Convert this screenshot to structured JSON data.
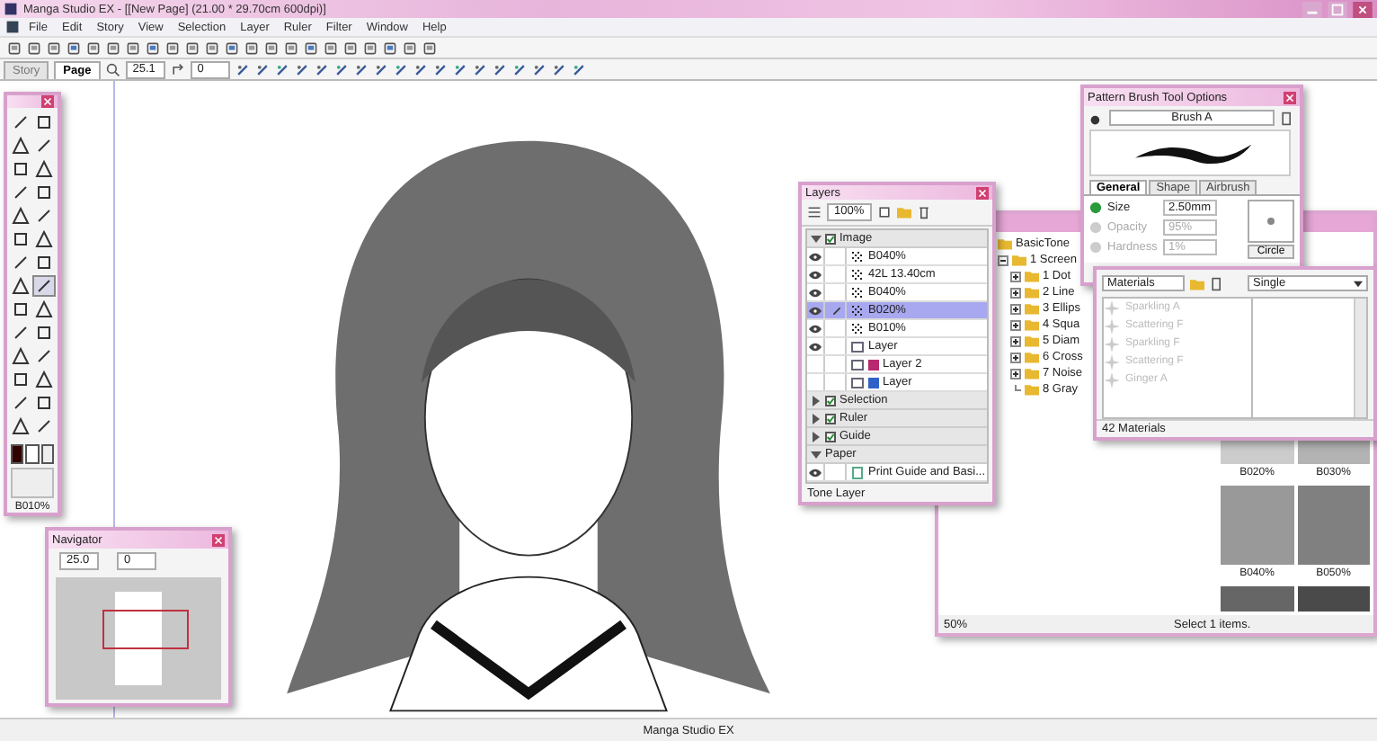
{
  "window": {
    "title": "Manga Studio EX - [[New Page] (21.00 * 29.70cm 600dpi)]"
  },
  "menu": [
    "File",
    "Edit",
    "Story",
    "View",
    "Selection",
    "Layer",
    "Ruler",
    "Filter",
    "Window",
    "Help"
  ],
  "doc_tabs": [
    {
      "label": "Story",
      "selected": false
    },
    {
      "label": "Page",
      "selected": true
    }
  ],
  "view_toolbar": {
    "zoom": "25.1",
    "rotation": "0"
  },
  "tools_palette": {
    "tools": [
      {
        "selected": false
      },
      {
        "selected": false
      },
      {
        "selected": false
      },
      {
        "selected": false
      },
      {
        "selected": false
      },
      {
        "selected": false
      },
      {
        "selected": false
      },
      {
        "selected": false
      },
      {
        "selected": false
      },
      {
        "selected": false
      },
      {
        "selected": false
      },
      {
        "selected": false
      },
      {
        "selected": false
      },
      {
        "selected": false
      },
      {
        "selected": false
      },
      {
        "selected": true
      },
      {
        "selected": false
      },
      {
        "selected": false
      },
      {
        "selected": false
      },
      {
        "selected": false
      },
      {
        "selected": false
      },
      {
        "selected": false
      },
      {
        "selected": false
      },
      {
        "selected": false
      },
      {
        "selected": false
      },
      {
        "selected": false
      },
      {
        "selected": false
      },
      {
        "selected": false
      }
    ],
    "tone_label": "B010%"
  },
  "navigator": {
    "title": "Navigator",
    "zoom": "25.0",
    "rotation": "0"
  },
  "layers": {
    "title": "Layers",
    "opacity": "100%",
    "folders": [
      {
        "name": "Image",
        "expanded": true,
        "checked": true,
        "children": [
          {
            "name": "B040%",
            "kind": "tone",
            "visible": true,
            "selected": false
          },
          {
            "name": "42L 13.40cm",
            "kind": "tone",
            "visible": true,
            "selected": false
          },
          {
            "name": "B040%",
            "kind": "tone",
            "visible": true,
            "selected": false
          },
          {
            "name": "B020%",
            "kind": "tone",
            "visible": true,
            "selected": true
          },
          {
            "name": "B010%",
            "kind": "tone",
            "visible": true,
            "selected": false
          },
          {
            "name": "Layer",
            "kind": "raster",
            "visible": true,
            "selected": false
          },
          {
            "name": "Layer 2",
            "kind": "raster",
            "visible": false,
            "selected": false,
            "color": "#b8286e"
          },
          {
            "name": "Layer",
            "kind": "raster",
            "visible": false,
            "selected": false,
            "color": "#2f62c8"
          }
        ]
      },
      {
        "name": "Selection",
        "expanded": false,
        "checked": true
      },
      {
        "name": "Ruler",
        "expanded": false,
        "checked": true
      },
      {
        "name": "Guide",
        "expanded": false,
        "checked": true
      },
      {
        "name": "Paper",
        "expanded": true,
        "checked": false,
        "children": [
          {
            "name": "Print Guide and Basi...",
            "kind": "paper",
            "visible": true,
            "selected": false
          }
        ]
      }
    ],
    "footer": "Tone Layer"
  },
  "material_browser": {
    "tree": {
      "label": "BasicTone",
      "children": [
        {
          "label": "1 Screen",
          "expanded": true,
          "children": [
            {
              "label": "1 Dot",
              "expandable": true
            },
            {
              "label": "2 Line",
              "expandable": true
            },
            {
              "label": "3 Ellips",
              "expandable": true
            },
            {
              "label": "4 Squa",
              "expandable": true
            },
            {
              "label": "5 Diam",
              "expandable": true
            },
            {
              "label": "6 Cross",
              "expandable": true
            },
            {
              "label": "7 Noise",
              "expandable": true
            },
            {
              "label": "8 Gray",
              "expandable": false
            }
          ]
        }
      ]
    },
    "swatches": [
      "B020%",
      "B030%",
      "B040%",
      "B050%"
    ],
    "zoom": "50%",
    "status": "Select 1 items."
  },
  "brush_options": {
    "title": "Pattern Brush Tool Options",
    "brush": "Brush A",
    "tabs": [
      {
        "label": "General",
        "selected": true
      },
      {
        "label": "Shape",
        "selected": false
      },
      {
        "label": "Airbrush",
        "selected": false
      }
    ],
    "params": [
      {
        "label": "Size",
        "value": "2.50mm",
        "enabled": true
      },
      {
        "label": "Opacity",
        "value": "95%",
        "enabled": false
      },
      {
        "label": "Hardness",
        "value": "1%",
        "enabled": false
      }
    ],
    "tip": "Circle"
  },
  "materials": {
    "search": "Materials",
    "mode": "Single",
    "items": [
      "Sparkling A",
      "Scattering F",
      "Sparkling F",
      "Scattering F",
      "Ginger A"
    ],
    "count": "42 Materials"
  },
  "status_bar": "Manga Studio EX"
}
